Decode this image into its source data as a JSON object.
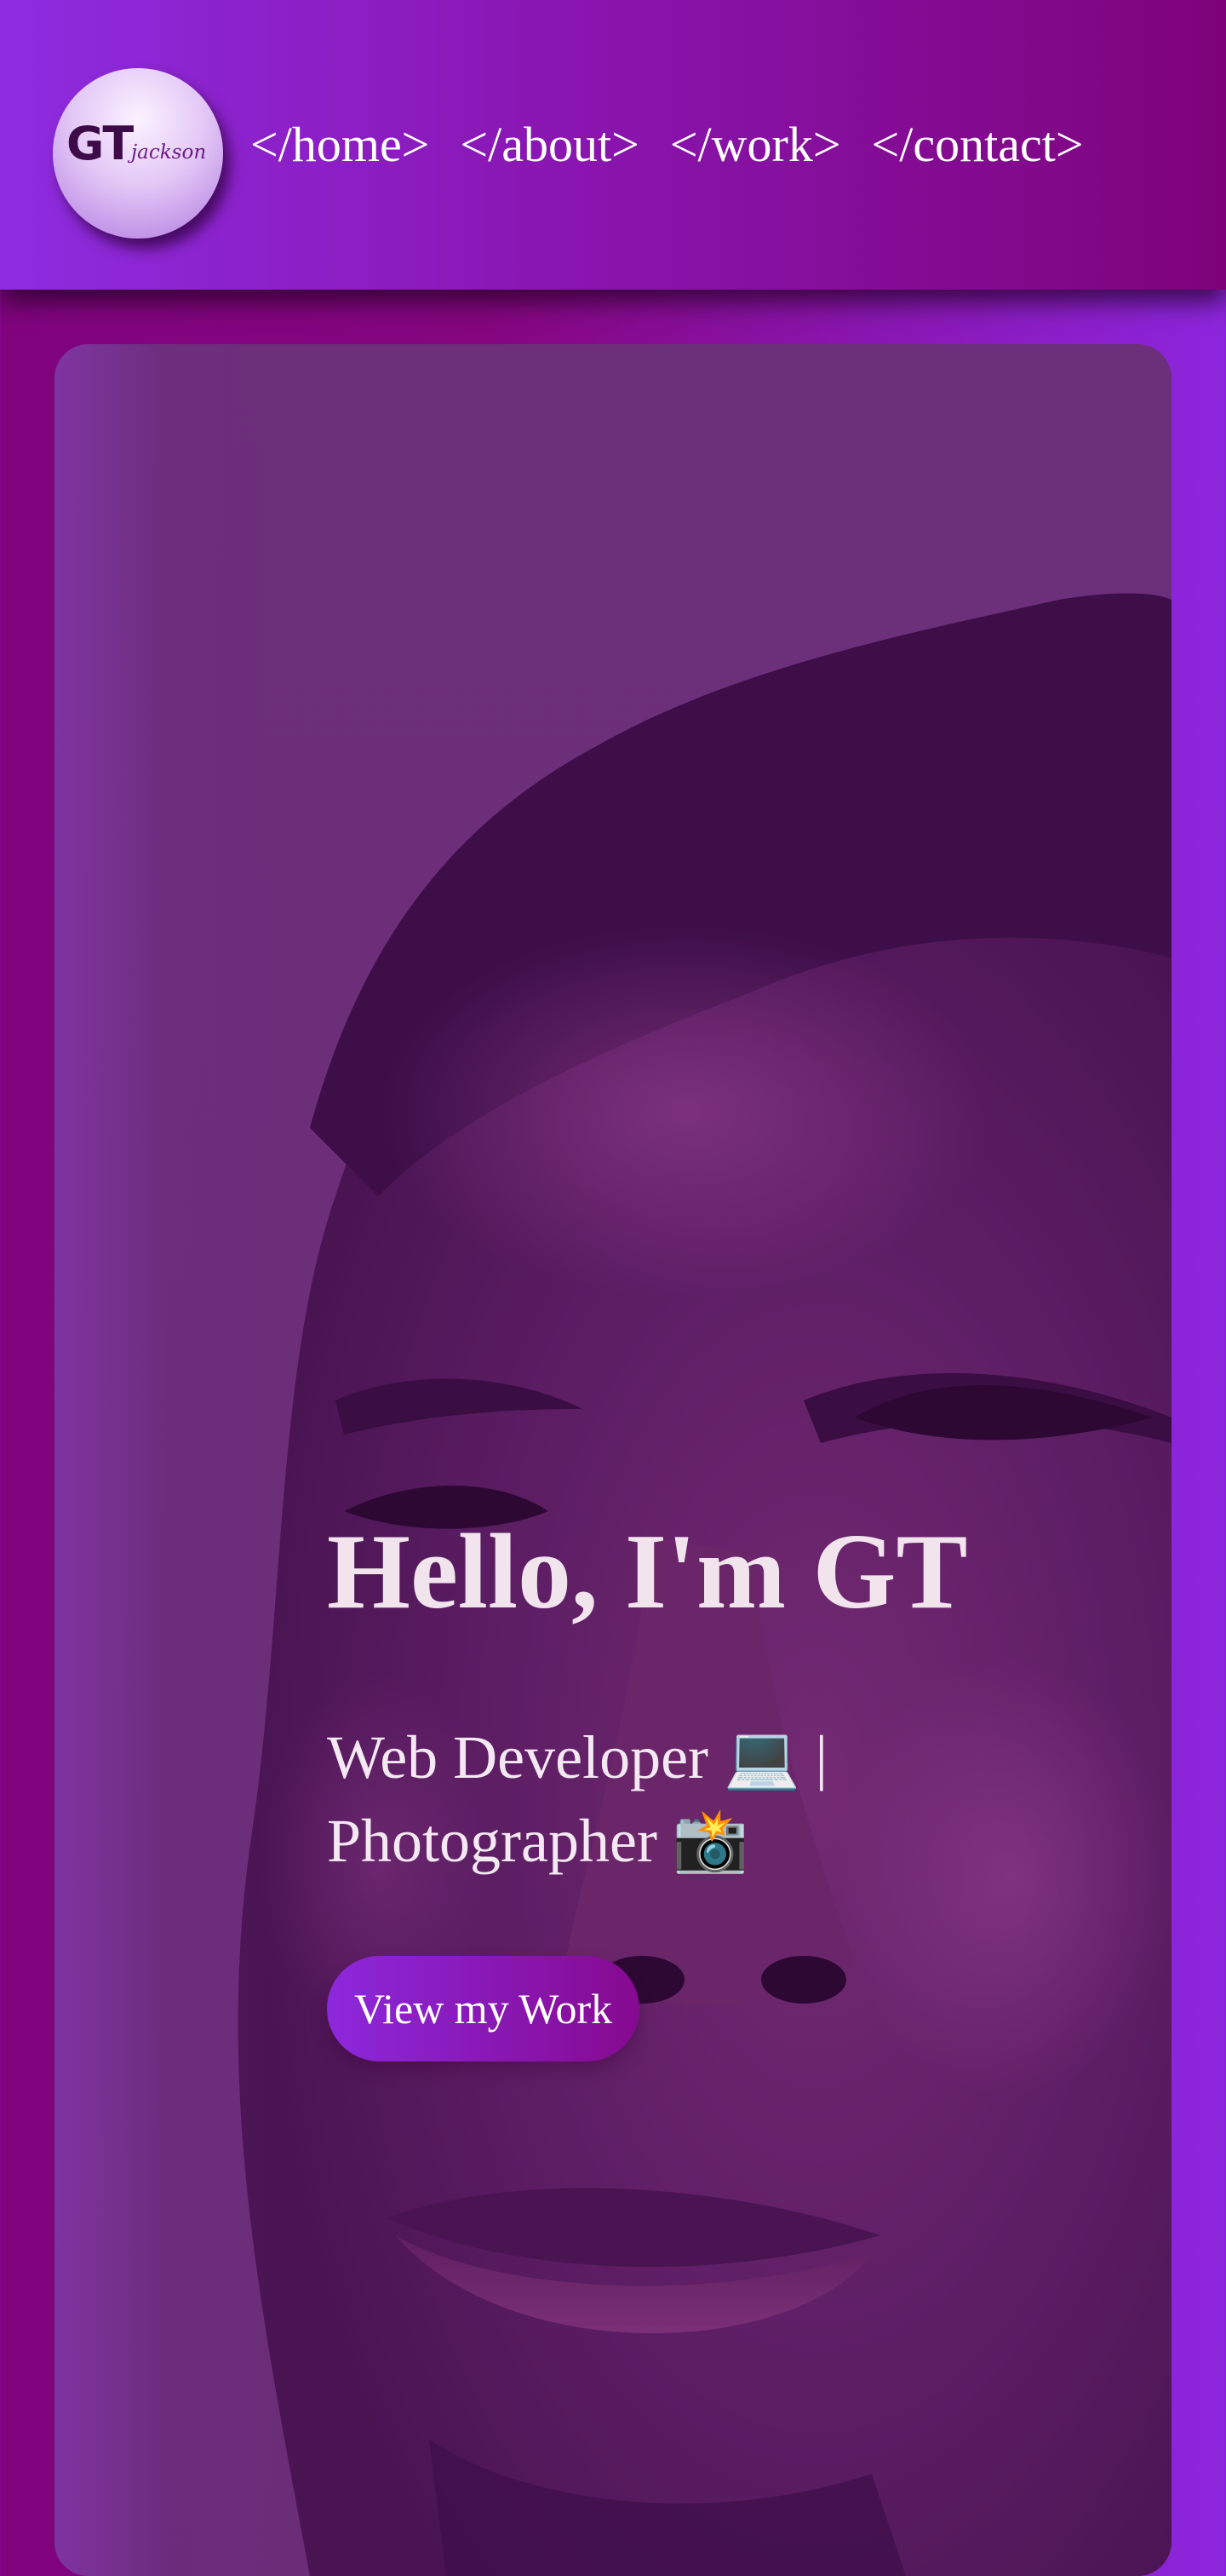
{
  "header": {
    "logo_text": "GT",
    "logo_subtext": "jackson",
    "nav": [
      {
        "label": "</home>"
      },
      {
        "label": "</about>"
      },
      {
        "label": "</work>"
      },
      {
        "label": "</contact>"
      }
    ]
  },
  "hero": {
    "title": "Hello, I'm GT",
    "subtitle": "Web Developer 💻 | Photographer 📸",
    "cta_label": "View my Work",
    "background_image": "portrait-photo"
  },
  "colors": {
    "accent_purple": "#8d26de",
    "deep_magenta": "#80047e",
    "overlay_purple": "#6b2d78"
  }
}
